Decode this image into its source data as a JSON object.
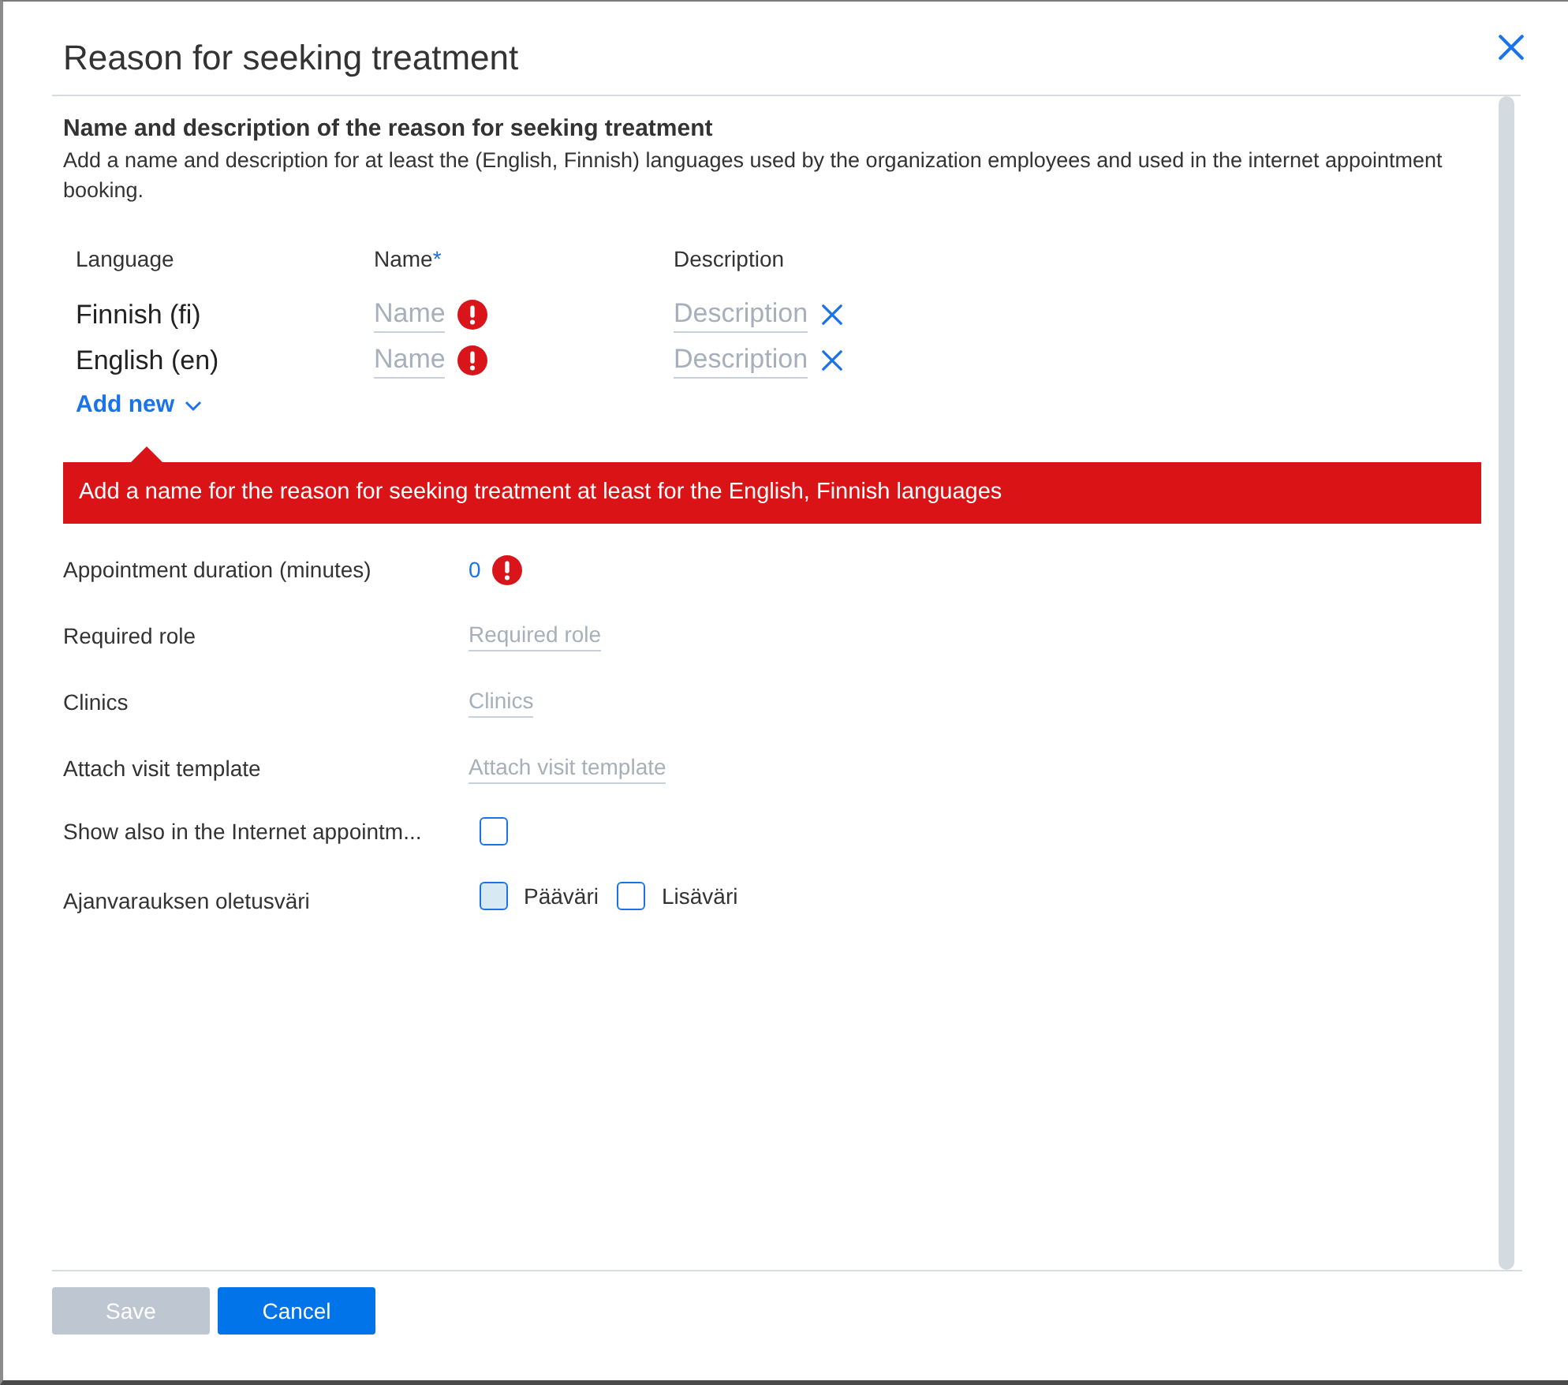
{
  "dialog": {
    "title": "Reason for seeking treatment"
  },
  "names_section": {
    "heading": "Name and description of the reason for seeking treatment",
    "description": "Add a name and description for at least the (English, Finnish) languages used by the organization employees and used in the internet appointment booking.",
    "columns": [
      {
        "label": "Language"
      },
      {
        "label": "Name",
        "required_mark": "*"
      },
      {
        "label": "Description"
      }
    ],
    "rows": [
      {
        "language": "Finnish (fi)",
        "name_placeholder": "Name",
        "name_error": true,
        "description_placeholder": "Description"
      },
      {
        "language": "English (en)",
        "name_placeholder": "Name",
        "name_error": true,
        "description_placeholder": "Description"
      }
    ],
    "add_new": "Add new"
  },
  "error_message": "Add a name for the reason for seeking treatment at least for the English, Finnish languages",
  "fields": [
    {
      "kind": "value",
      "label": "Appointment duration (minutes)",
      "value": "0",
      "error": true
    },
    {
      "kind": "picker",
      "label": "Required role",
      "placeholder": "Required role"
    },
    {
      "kind": "picker",
      "label": "Clinics",
      "placeholder": "Clinics"
    },
    {
      "kind": "picker",
      "label": "Attach visit template",
      "placeholder": "Attach visit template"
    },
    {
      "kind": "checkbox",
      "label": "Show also in the Internet appointm...",
      "checked": false
    },
    {
      "kind": "options",
      "label": "Ajanvarauksen oletusväri",
      "options": [
        {
          "label": "Pääväri",
          "selected": true
        },
        {
          "label": "Lisäväri",
          "selected": false
        }
      ]
    }
  ],
  "buttons": [
    {
      "label": "Save",
      "disabled": true
    },
    {
      "label": "Cancel",
      "disabled": false
    }
  ]
}
